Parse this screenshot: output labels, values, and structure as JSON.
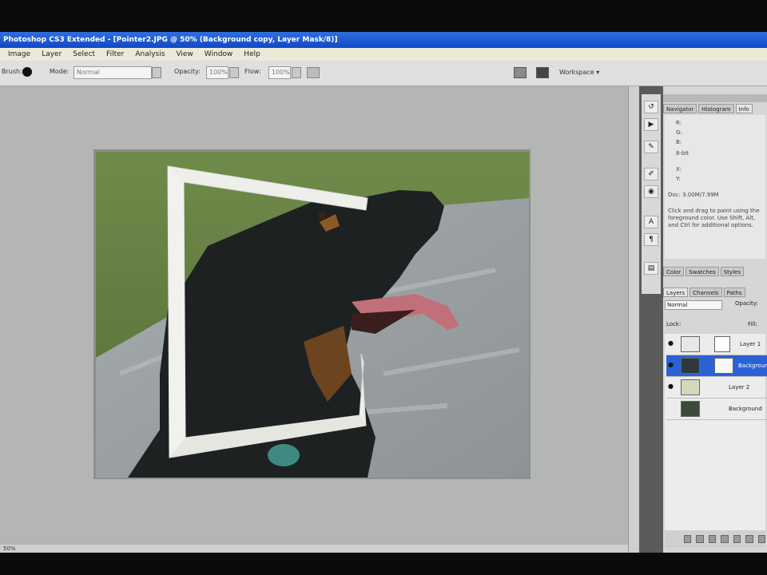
{
  "window": {
    "title": "Photoshop CS3 Extended - [Pointer2.JPG @ 50% (Background copy, Layer Mask/8)]"
  },
  "menu": [
    "Image",
    "Layer",
    "Select",
    "Filter",
    "Analysis",
    "View",
    "Window",
    "Help"
  ],
  "options_bar": {
    "tool_label": "Brush:",
    "mode_label": "Mode:",
    "mode_value": "Normal",
    "opacity_label": "Opacity:",
    "opacity_value": "100%",
    "flow_label": "Flow:",
    "flow_value": "100%",
    "workspace_label": "Workspace ▾"
  },
  "panels": {
    "tabs_top": [
      "Navigator",
      "Histogram",
      "Info"
    ],
    "info_lines": [
      "R:",
      "G:",
      "B:",
      "8-bit",
      "X:",
      "Y:",
      "Doc: 3.00M/7.99M",
      "Click and drag to paint using the foreground color. Use Shift, Alt, and Ctrl for additional options."
    ],
    "tabs_mid": [
      "Color",
      "Swatches",
      "Styles"
    ],
    "tabs_layers": [
      "Layers",
      "Channels",
      "Paths"
    ],
    "blend_mode": "Normal",
    "opacity_label": "Opacity:",
    "lock_label": "Lock:",
    "fill_label": "Fill:",
    "layers": [
      {
        "name": "Layer 1",
        "visible": true,
        "selected": false
      },
      {
        "name": "Background copy",
        "visible": true,
        "selected": true
      },
      {
        "name": "Layer 2",
        "visible": true,
        "selected": false
      },
      {
        "name": "Background",
        "visible": false,
        "selected": false
      }
    ]
  },
  "status": {
    "zoom": "50%"
  },
  "colors": {
    "titlebar": "#1f5fd8",
    "canvas_bg": "#b4b6b4",
    "selected_layer": "#2a62d6",
    "frame": "#eeeeea"
  }
}
